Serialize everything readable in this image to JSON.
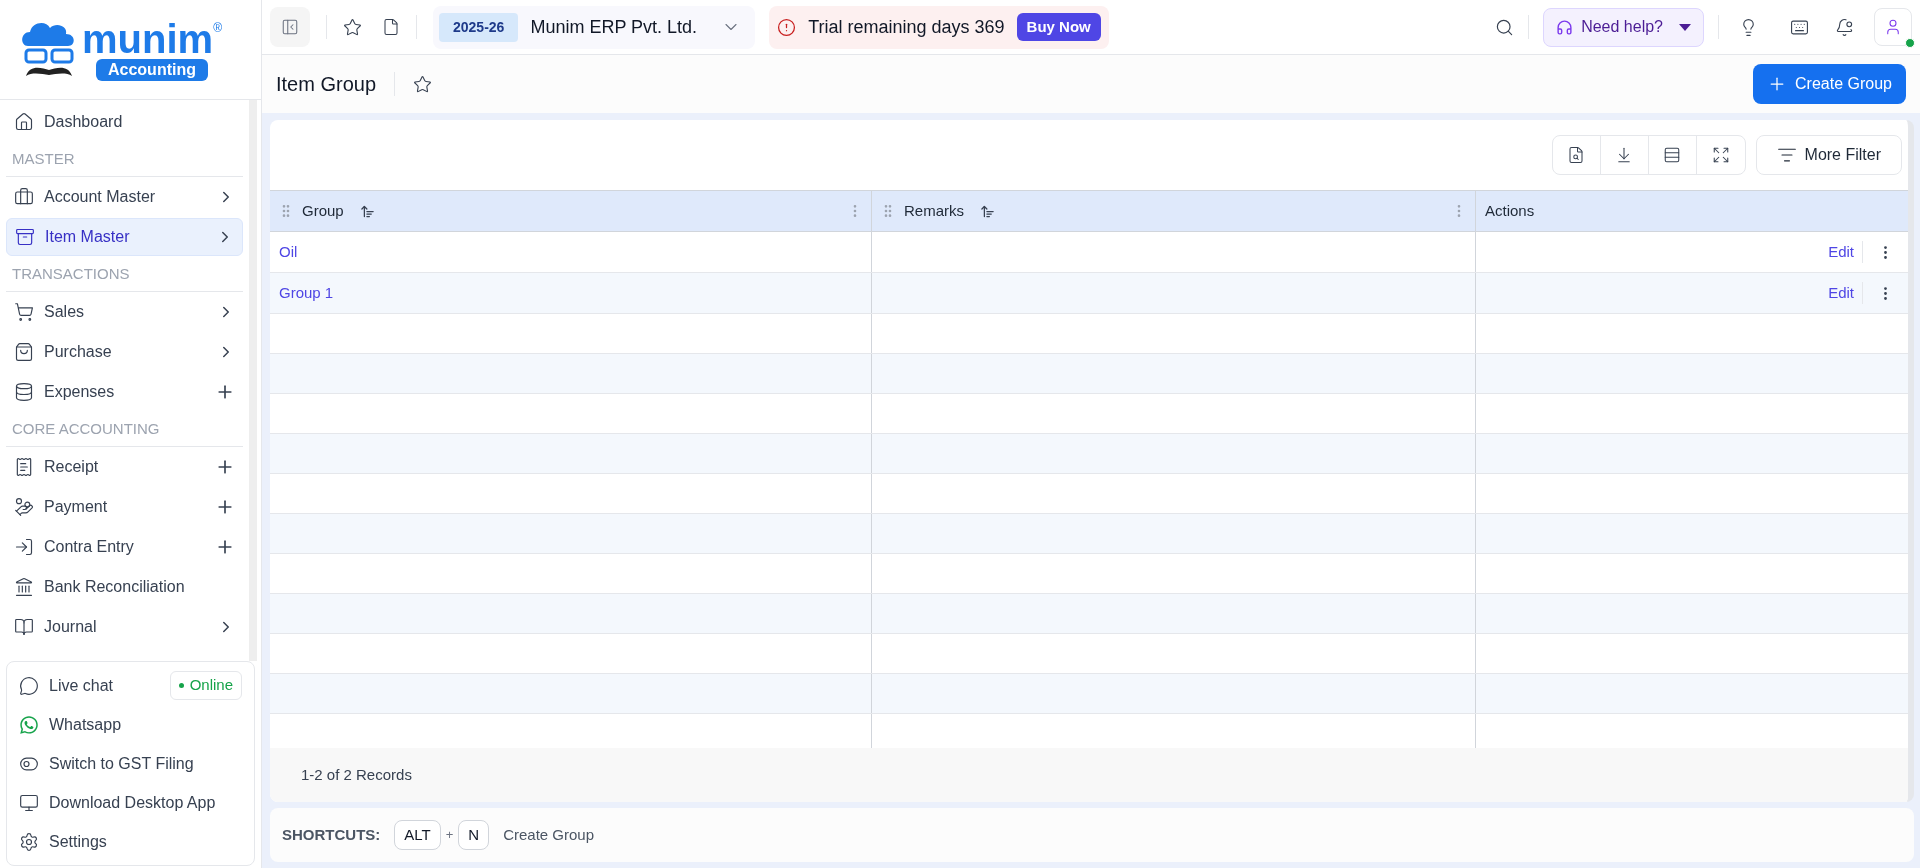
{
  "logo": {
    "name": "munim",
    "mark": "®",
    "tagline": "Accounting"
  },
  "sidebar": {
    "items": [
      {
        "kind": "item",
        "label": "Dashboard",
        "has_submenu": false,
        "has_add": false,
        "selected": false
      },
      {
        "kind": "section",
        "label": "MASTER"
      },
      {
        "kind": "item",
        "label": "Account Master",
        "has_submenu": true,
        "has_add": false,
        "selected": false
      },
      {
        "kind": "item",
        "label": "Item Master",
        "has_submenu": true,
        "has_add": false,
        "selected": true
      },
      {
        "kind": "section",
        "label": "TRANSACTIONS"
      },
      {
        "kind": "item",
        "label": "Sales",
        "has_submenu": true,
        "has_add": false,
        "selected": false
      },
      {
        "kind": "item",
        "label": "Purchase",
        "has_submenu": true,
        "has_add": false,
        "selected": false
      },
      {
        "kind": "item",
        "label": "Expenses",
        "has_submenu": false,
        "has_add": true,
        "selected": false
      },
      {
        "kind": "section",
        "label": "CORE ACCOUNTING"
      },
      {
        "kind": "item",
        "label": "Receipt",
        "has_submenu": false,
        "has_add": true,
        "selected": false
      },
      {
        "kind": "item",
        "label": "Payment",
        "has_submenu": false,
        "has_add": true,
        "selected": false
      },
      {
        "kind": "item",
        "label": "Contra Entry",
        "has_submenu": false,
        "has_add": true,
        "selected": false
      },
      {
        "kind": "item",
        "label": "Bank Reconciliation",
        "has_submenu": false,
        "has_add": false,
        "selected": false
      },
      {
        "kind": "item",
        "label": "Journal",
        "has_submenu": true,
        "has_add": false,
        "selected": false
      }
    ],
    "support": [
      {
        "label": "Live chat",
        "status": "Online"
      },
      {
        "label": "Whatsapp"
      },
      {
        "label": "Switch to GST Filing"
      },
      {
        "label": "Download Desktop App"
      },
      {
        "label": "Settings"
      }
    ]
  },
  "topbar": {
    "year": "2025-26",
    "company": "Munim ERP Pvt. Ltd.",
    "trial": "Trial remaining days 369",
    "buy": "Buy Now",
    "help": "Need help?"
  },
  "page": {
    "title": "Item Group",
    "create": "Create Group",
    "more_filter": "More Filter"
  },
  "table": {
    "columns": [
      "Group",
      "Remarks",
      "Actions"
    ],
    "rows": [
      {
        "group": "Oil",
        "action": "Edit"
      },
      {
        "group": "Group 1",
        "action": "Edit"
      }
    ],
    "footer": "1-2 of 2 Records"
  },
  "shortcuts": {
    "label": "SHORTCUTS:",
    "keys": [
      "ALT",
      "N"
    ],
    "joiner": "+",
    "action": "Create Group"
  }
}
